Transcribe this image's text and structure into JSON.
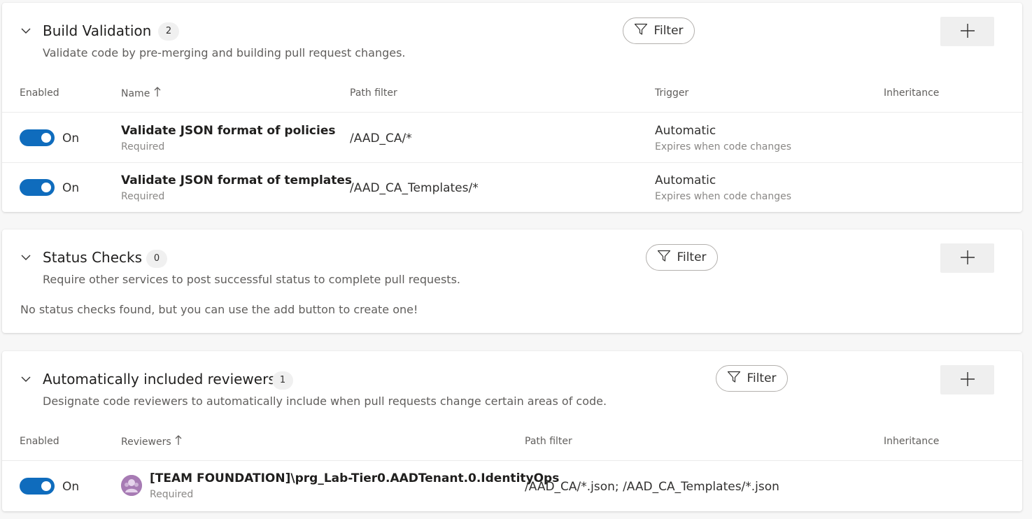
{
  "build_validation": {
    "title": "Build Validation",
    "count": "2",
    "description": "Validate code by pre-merging and building pull request changes.",
    "filter_label": "Filter",
    "columns": {
      "enabled": "Enabled",
      "name": "Name",
      "path_filter": "Path filter",
      "trigger": "Trigger",
      "inheritance": "Inheritance"
    },
    "rows": [
      {
        "enabled": true,
        "toggle_label": "On",
        "name": "Validate JSON format of policies",
        "requirement": "Required",
        "path_filter": "/AAD_CA/*",
        "trigger": "Automatic",
        "trigger_detail": "Expires when code changes"
      },
      {
        "enabled": true,
        "toggle_label": "On",
        "name": "Validate JSON format of templates",
        "requirement": "Required",
        "path_filter": "/AAD_CA_Templates/*",
        "trigger": "Automatic",
        "trigger_detail": "Expires when code changes"
      }
    ]
  },
  "status_checks": {
    "title": "Status Checks",
    "count": "0",
    "description": "Require other services to post successful status to complete pull requests.",
    "filter_label": "Filter",
    "empty_message": "No status checks found, but you can use the add button to create one!"
  },
  "auto_reviewers": {
    "title": "Automatically included reviewers",
    "count": "1",
    "description": "Designate code reviewers to automatically include when pull requests change certain areas of code.",
    "filter_label": "Filter",
    "columns": {
      "enabled": "Enabled",
      "reviewers": "Reviewers",
      "path_filter": "Path filter",
      "inheritance": "Inheritance"
    },
    "rows": [
      {
        "enabled": true,
        "toggle_label": "On",
        "reviewer": "[TEAM FOUNDATION]\\prg_Lab-Tier0.AADTenant.0.IdentityOps",
        "requirement": "Required",
        "path_filter": "/AAD_CA/*.json; /AAD_CA_Templates/*.json"
      }
    ]
  },
  "colors": {
    "toggle_on": "#0f6cbd",
    "add_button_bg": "#efefef"
  },
  "icons": {
    "collapse": "chevron-down-icon",
    "filter": "funnel-icon",
    "add": "plus-icon",
    "sort": "arrow-up-icon",
    "avatar": "group-avatar-icon"
  }
}
